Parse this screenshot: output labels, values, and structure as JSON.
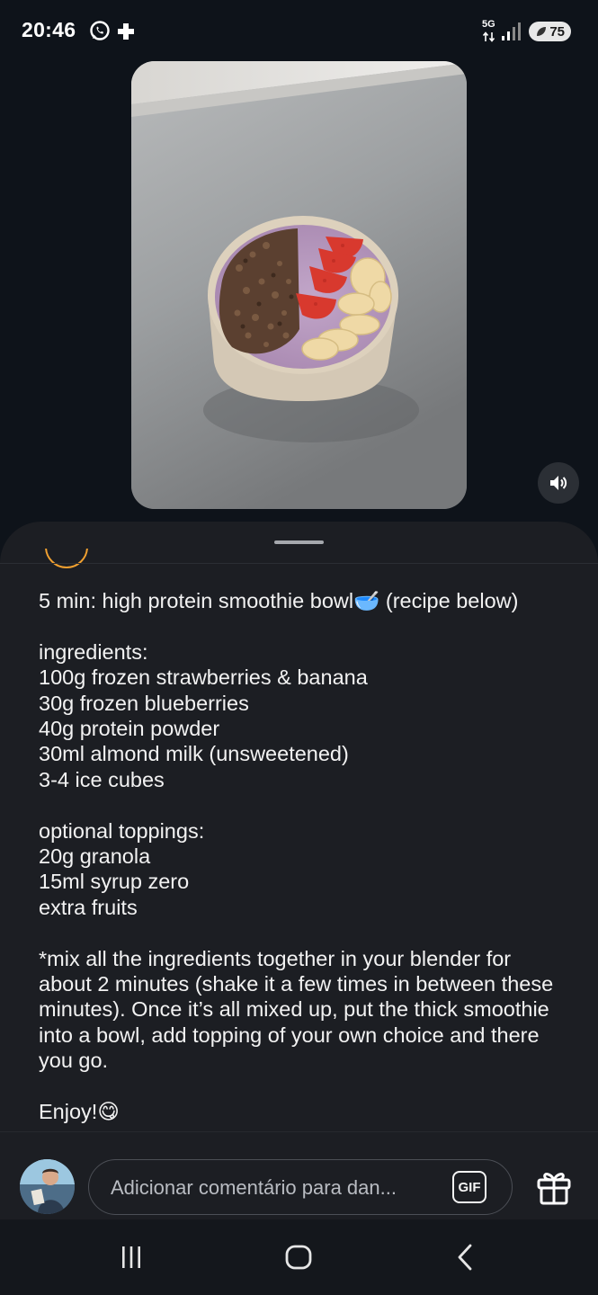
{
  "status_bar": {
    "time": "20:46",
    "network": "5G",
    "battery": "75"
  },
  "post": {
    "caption_paragraphs": [
      "5 min: high protein smoothie bowl🥣 (recipe below)",
      "ingredients:\n100g frozen strawberries & banana\n30g frozen blueberries\n40g protein powder\n30ml almond milk (unsweetened)\n3-4 ice cubes",
      "optional toppings:\n20g granola\n15ml syrup zero\nextra fruits",
      "*mix all the ingredients together in your blender for about 2 minutes (shake it a few times in between these minutes). Once it’s all mixed up, put the thick smoothie into a bowl, add topping of your own choice and there you go.",
      "Enjoy!😋"
    ]
  },
  "comment_bar": {
    "placeholder": "Adicionar comentário para dan...",
    "gif_label": "GIF"
  },
  "icons": {
    "whatsapp": "whatsapp-icon",
    "notification": "plus-notification-icon",
    "signal": "signal-icon",
    "sound": "speaker-icon",
    "gift": "gift-icon",
    "nav_recents": "recents-icon",
    "nav_home": "home-icon",
    "nav_back": "back-icon"
  }
}
